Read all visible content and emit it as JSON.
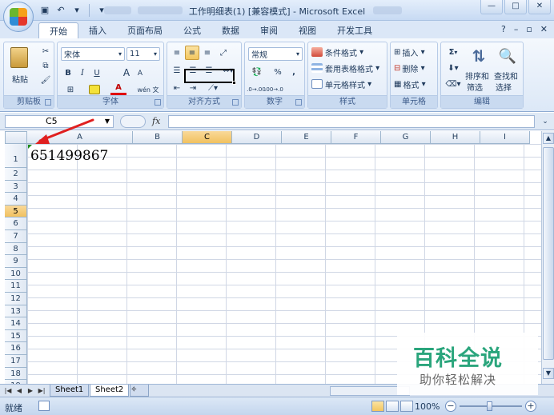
{
  "window": {
    "title": "工作明细表(1)  [兼容模式] - Microsoft Excel",
    "controls": [
      "—",
      "□",
      "✕"
    ]
  },
  "tabs": [
    {
      "label": "开始",
      "active": true
    },
    {
      "label": "插入"
    },
    {
      "label": "页面布局"
    },
    {
      "label": "公式"
    },
    {
      "label": "数据"
    },
    {
      "label": "审阅"
    },
    {
      "label": "视图"
    },
    {
      "label": "开发工具"
    }
  ],
  "tab_right": [
    "?",
    "–",
    "▫",
    "✕"
  ],
  "ribbon": {
    "clipboard": {
      "label": "剪贴板",
      "paste": "粘贴"
    },
    "font": {
      "label": "字体",
      "font_name": "宋体",
      "font_size": "11",
      "bold": "B",
      "italic": "I",
      "underline": "U",
      "grow": "A",
      "shrink": "A",
      "wen": "wén 文"
    },
    "alignment": {
      "label": "对齐方式"
    },
    "number": {
      "label": "数字",
      "format": "常规",
      "percent": "%",
      "comma": ","
    },
    "styles": {
      "label": "样式",
      "conditional": "条件格式",
      "table": "套用表格格式",
      "cell_styles": "单元格样式"
    },
    "cells": {
      "label": "单元格",
      "insert": "插入",
      "delete": "删除",
      "format": "格式"
    },
    "editing": {
      "label": "编辑",
      "sum": "Σ",
      "sort": "排序和",
      "sort2": "筛选",
      "find": "查找和",
      "find2": "选择"
    }
  },
  "formula_bar": {
    "name_box": "C5",
    "fx": "fx",
    "value": ""
  },
  "columns": [
    "A",
    "B",
    "C",
    "D",
    "E",
    "F",
    "G",
    "H",
    "I"
  ],
  "selected_column": "C",
  "rows": [
    "1",
    "2",
    "3",
    "4",
    "5",
    "6",
    "7",
    "8",
    "9",
    "10",
    "11",
    "12",
    "13",
    "14",
    "15",
    "16",
    "17",
    "18",
    "19"
  ],
  "selected_row": "5",
  "cells": {
    "A1": "651499867"
  },
  "sheets": [
    {
      "label": "Sheet1"
    },
    {
      "label": "Sheet2",
      "active": true
    }
  ],
  "status": {
    "mode": "就绪",
    "zoom": "100%"
  },
  "watermark": {
    "title": "百科全说",
    "subtitle": "助你轻松解决"
  },
  "colors": {
    "arrow": "#e02020",
    "watermark": "#2aa57c",
    "selection_header": "#f1c15f"
  }
}
